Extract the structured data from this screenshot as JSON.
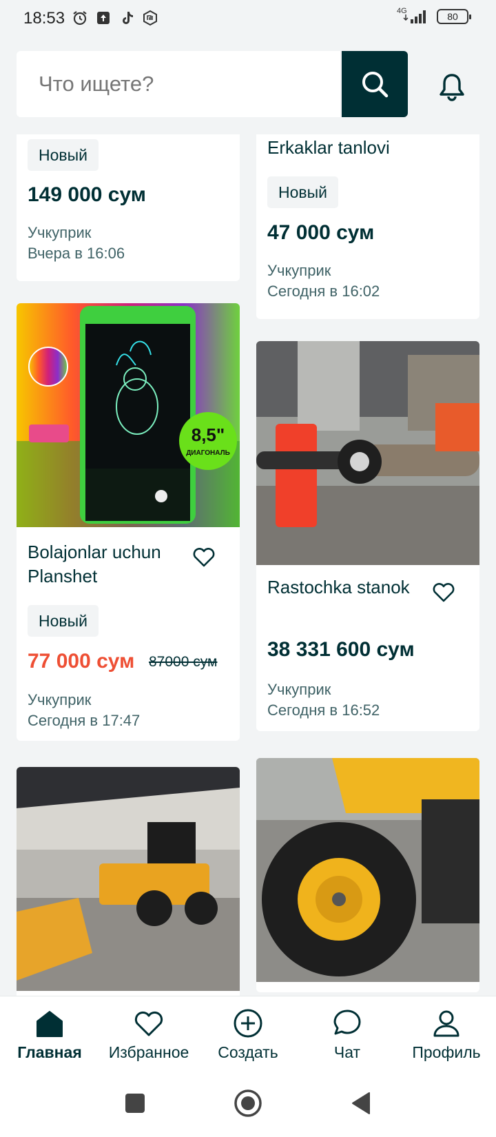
{
  "status_bar": {
    "time": "18:53",
    "network": "4G",
    "battery": "80"
  },
  "search": {
    "placeholder": "Что ищете?"
  },
  "listings": [
    {
      "title": "",
      "badge": "Новый",
      "price": "149 000 сум",
      "location": "Учкуприк",
      "date": "Вчера в 16:06"
    },
    {
      "title": "Erkaklar tanlovi",
      "badge": "Новый",
      "price": "47 000 сум",
      "location": "Учкуприк",
      "date": "Сегодня в 16:02"
    },
    {
      "title": "Bolajonlar uchun Planshet",
      "badge": "Новый",
      "price": "77 000 сум",
      "old_price": "87000 сум",
      "location": "Учкуприк",
      "date": "Сегодня в 17:47"
    },
    {
      "title": "Rastochka stanok",
      "price": "38 331 600 сум",
      "location": "Учкуприк",
      "date": "Сегодня в 16:52"
    }
  ],
  "tablet_image": {
    "tag_size": "8,5\"",
    "tag_word": "ДИАГОНАЛЬ"
  },
  "bottom_nav": [
    {
      "label": "Главная",
      "icon": "home-icon",
      "active": true
    },
    {
      "label": "Избранное",
      "icon": "heart-icon"
    },
    {
      "label": "Создать",
      "icon": "plus-circle-icon"
    },
    {
      "label": "Чат",
      "icon": "chat-icon"
    },
    {
      "label": "Профиль",
      "icon": "profile-icon"
    }
  ],
  "colors": {
    "primary": "#002f34",
    "sale": "#ee4f34",
    "background": "#f2f4f5"
  }
}
